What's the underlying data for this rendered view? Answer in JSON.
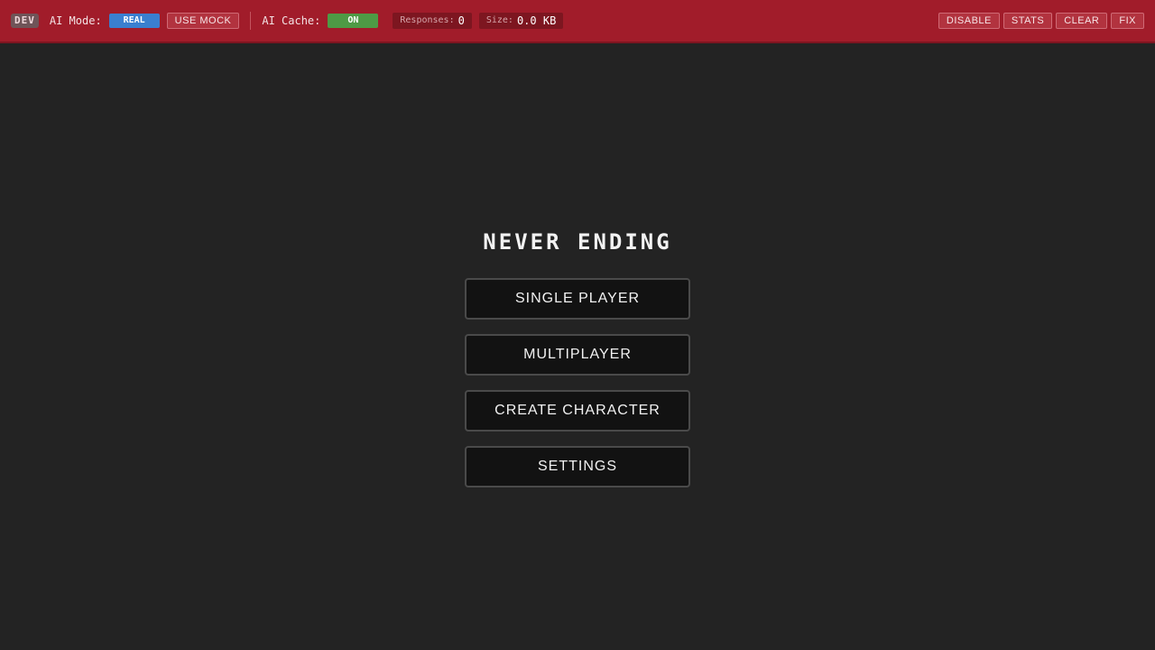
{
  "devbar": {
    "badge": "DEV",
    "ai_mode_label": "AI Mode:",
    "ai_mode_value": "REAL",
    "use_mock_label": "USE MOCK",
    "ai_cache_label": "AI Cache:",
    "ai_cache_value": "ON",
    "responses_label": "Responses:",
    "responses_value": "0",
    "size_label": "Size:",
    "size_value": "0.0 KB",
    "buttons": {
      "disable": "DISABLE",
      "stats": "STATS",
      "clear": "CLEAR",
      "fix": "FIX"
    },
    "colors": {
      "bar": "#a11c2a",
      "mode_pill": "#3a7fd0",
      "cache_pill": "#4e9a45"
    }
  },
  "menu": {
    "title": "NEVER ENDING",
    "items": [
      {
        "label": "SINGLE PLAYER"
      },
      {
        "label": "MULTIPLAYER"
      },
      {
        "label": "CREATE CHARACTER"
      },
      {
        "label": "SETTINGS"
      }
    ]
  }
}
